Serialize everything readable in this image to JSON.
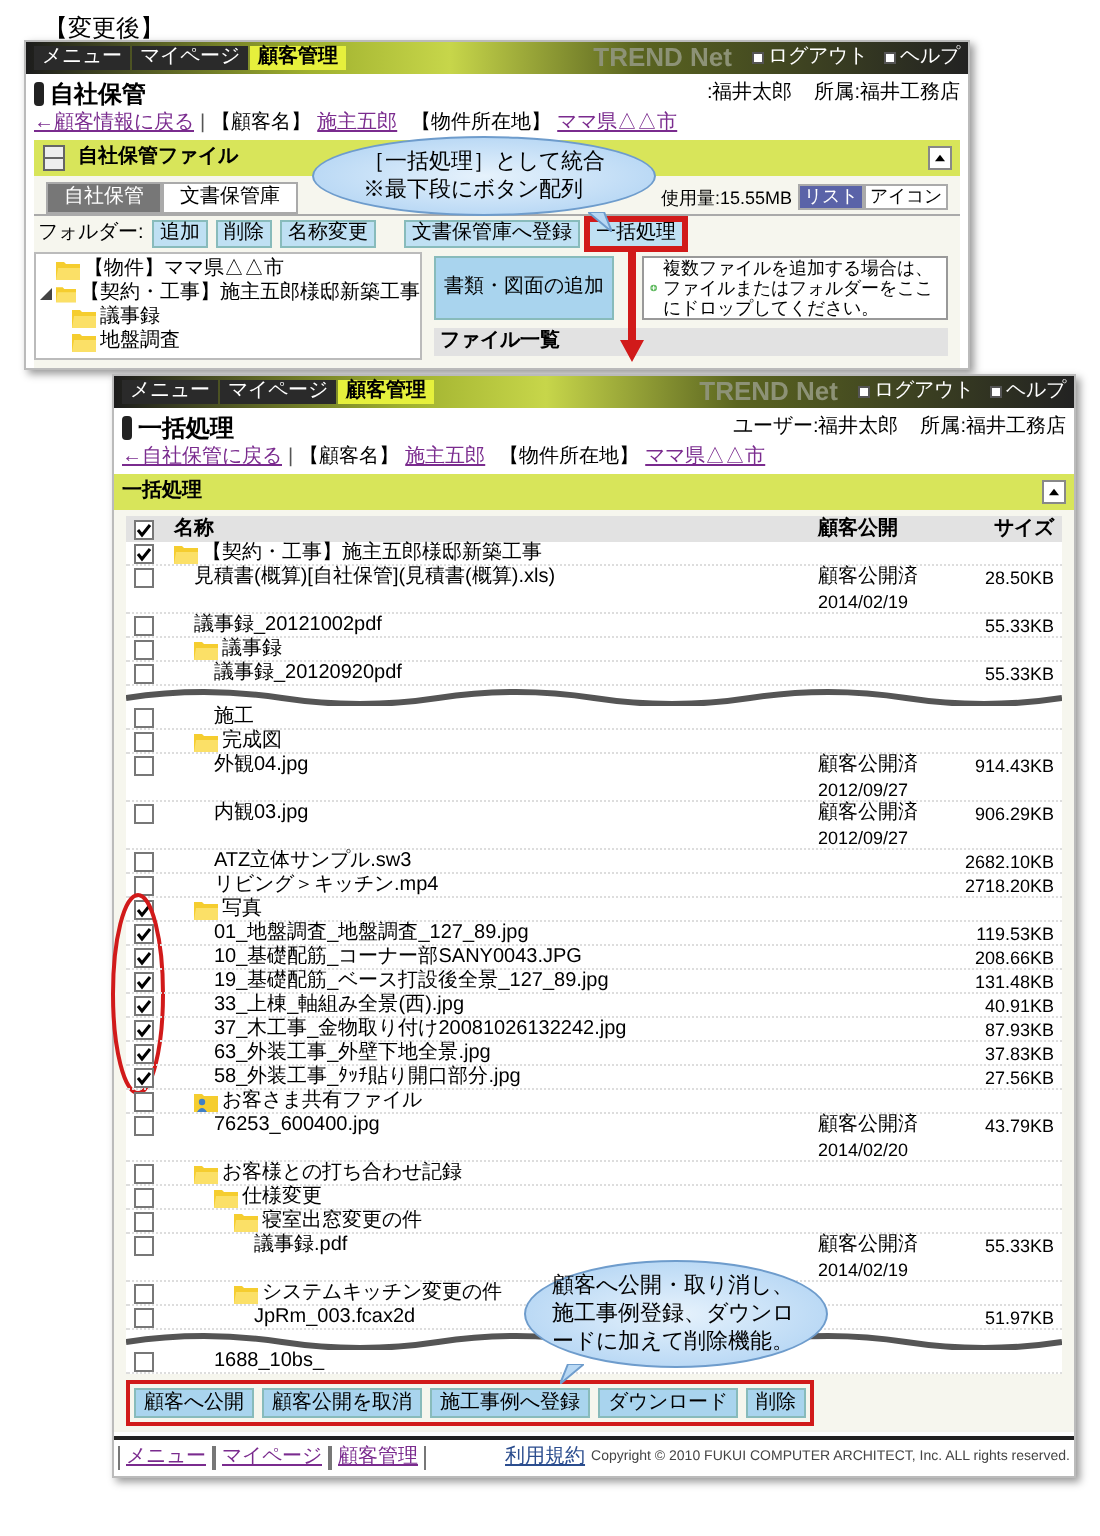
{
  "heading": "【変更後】",
  "screen1": {
    "nav": {
      "tabs": [
        {
          "label": "メニュー",
          "selected": false
        },
        {
          "label": "マイページ",
          "selected": false
        },
        {
          "label": "顧客管理",
          "selected": true
        }
      ],
      "brand": "TREND Net",
      "links": [
        "ログアウト",
        "ヘルプ"
      ]
    },
    "title": "自社保管",
    "user": ":福井太郎",
    "affiliation": "所属:福井工務店",
    "breadcrumb": {
      "back": "←顧客情報に戻る",
      "separator": "|",
      "customer_label": "【顧客名】",
      "customer": "施主五郎",
      "location_label": "【物件所在地】",
      "location": "ママ県△△市"
    },
    "section": "自社保管ファイル",
    "tabs": [
      {
        "label": "自社保管",
        "selected": true
      },
      {
        "label": "文書保管庫",
        "selected": false
      }
    ],
    "usage": "使用量:15.55MB",
    "views": [
      {
        "label": "リスト",
        "selected": true
      },
      {
        "label": "アイコン",
        "selected": false
      }
    ],
    "folder_label": "フォルダー:",
    "folder_buttons": [
      "追加",
      "削除",
      "名称変更"
    ],
    "actions": [
      {
        "label": "文書保管庫へ登録",
        "highlighted": false
      },
      {
        "label": "一括処理",
        "highlighted": true
      }
    ],
    "tree": [
      {
        "name": "【物件】ママ県△△市"
      },
      {
        "name": "【契約・工事】施主五郎様邸新築工事",
        "expanded": true,
        "children": [
          {
            "name": "議事録"
          },
          {
            "name": "地盤調査"
          }
        ]
      }
    ],
    "add_button": "書類・図面の追加",
    "drop_hint": "複数ファイルを追加する場合は、ファイルまたはフォルダーをここにドロップしてください。",
    "file_list": "ファイル一覧"
  },
  "callouts": [
    {
      "text": "［一括処理］として統合\n※最下段にボタン配列"
    },
    {
      "text": "顧客へ公開・取り消し、施工事例登録、ダウンロードに加えて削除機能。"
    }
  ],
  "screen2": {
    "nav": {
      "tabs": [
        {
          "label": "メニュー",
          "selected": false
        },
        {
          "label": "マイページ",
          "selected": false
        },
        {
          "label": "顧客管理",
          "selected": true
        }
      ],
      "brand": "TREND Net",
      "links": [
        "ログアウト",
        "ヘルプ"
      ]
    },
    "title": "一括処理",
    "user": "ユーザー:福井太郎",
    "affiliation": "所属:福井工務店",
    "breadcrumb": {
      "back": "←自社保管に戻る",
      "separator": "|",
      "customer_label": "【顧客名】",
      "customer": "施主五郎",
      "location_label": "【物件所在地】",
      "location": "ママ県△△市"
    },
    "section": "一括処理",
    "columns": [
      "名称",
      "顧客公開",
      "サイズ"
    ],
    "all_checked": true,
    "segments": [
      {
        "rows": [
          {
            "kind": "folder",
            "name": "【契約・工事】施主五郎様邸新築工事",
            "checked": true,
            "children": [
              {
                "kind": "file",
                "name": "見積書(概算)[自社保管](見積書(概算).xls)",
                "checked": false,
                "public": "顧客公開済",
                "date": "2014/02/19",
                "size": "28.50KB"
              },
              {
                "kind": "file",
                "name": "議事録_20121002pdf",
                "checked": false,
                "size": "55.33KB"
              },
              {
                "kind": "folder",
                "name": "議事録",
                "checked": false,
                "children": [
                  {
                    "kind": "file",
                    "name": "議事録_20120920pdf",
                    "checked": false,
                    "size": "55.33KB"
                  }
                ]
              }
            ]
          }
        ]
      },
      {
        "rows": [
          {
            "children": [
              {
                "children": [
                  {
                    "kind": "file",
                    "name": "施工",
                    "checked": false
                  }
                ]
              },
              {
                "kind": "folder",
                "name": "完成図",
                "checked": false,
                "children": [
                  {
                    "kind": "file",
                    "name": "外観04.jpg",
                    "checked": false,
                    "public": "顧客公開済",
                    "date": "2012/09/27",
                    "size": "914.43KB"
                  },
                  {
                    "kind": "file",
                    "name": "内観03.jpg",
                    "checked": false,
                    "public": "顧客公開済",
                    "date": "2012/09/27",
                    "size": "906.29KB"
                  },
                  {
                    "kind": "file",
                    "name": "ATZ立体サンプル.sw3",
                    "checked": false,
                    "size": "2682.10KB"
                  },
                  {
                    "kind": "file",
                    "name": "リビング＞キッチン.mp4",
                    "checked": false,
                    "size": "2718.20KB"
                  }
                ]
              },
              {
                "kind": "folder",
                "name": "写真",
                "checked": true,
                "highlighted": true,
                "children": [
                  {
                    "kind": "file",
                    "name": "01_地盤調査_地盤調査_127_89.jpg",
                    "checked": true,
                    "size": "119.53KB"
                  },
                  {
                    "kind": "file",
                    "name": "10_基礎配筋_コーナー部SANY0043.JPG",
                    "checked": true,
                    "size": "208.66KB"
                  },
                  {
                    "kind": "file",
                    "name": "19_基礎配筋_ベース打設後全景_127_89.jpg",
                    "checked": true,
                    "size": "131.48KB"
                  },
                  {
                    "kind": "file",
                    "name": "33_上棟_軸組み全景(西).jpg",
                    "checked": true,
                    "size": "40.91KB"
                  },
                  {
                    "kind": "file",
                    "name": "37_木工事_金物取り付け20081026132242.jpg",
                    "checked": true,
                    "size": "87.93KB"
                  },
                  {
                    "kind": "file",
                    "name": "63_外装工事_外壁下地全景.jpg",
                    "checked": true,
                    "size": "37.83KB"
                  },
                  {
                    "kind": "file",
                    "name": "58_外装工事_ﾀｯﾁ貼り開口部分.jpg",
                    "checked": true,
                    "size": "27.56KB"
                  }
                ]
              },
              {
                "kind": "shared",
                "name": "お客さま共有ファイル",
                "checked": false,
                "children": [
                  {
                    "kind": "file",
                    "name": "76253_600400.jpg",
                    "checked": false,
                    "public": "顧客公開済",
                    "date": "2014/02/20",
                    "size": "43.79KB"
                  }
                ]
              },
              {
                "kind": "folder",
                "name": "お客様との打ち合わせ記録",
                "checked": false,
                "children": [
                  {
                    "kind": "folder",
                    "name": "仕様変更",
                    "checked": false,
                    "children": [
                      {
                        "kind": "folder",
                        "name": "寝室出窓変更の件",
                        "checked": false,
                        "children": [
                          {
                            "kind": "file",
                            "name": "議事録.pdf",
                            "checked": false,
                            "public": "顧客公開済",
                            "date": "2014/02/19",
                            "size": "55.33KB"
                          }
                        ]
                      },
                      {
                        "kind": "folder",
                        "name": "システムキッチン変更の件",
                        "checked": false,
                        "children": [
                          {
                            "kind": "file",
                            "name": "JpRm_003.fcax2d",
                            "checked": false,
                            "size": "51.97KB"
                          }
                        ]
                      }
                    ]
                  }
                ]
              }
            ]
          }
        ]
      },
      {
        "rows": [
          {
            "children": [
              {
                "children": [
                  {
                    "kind": "file",
                    "name": "1688_10bs_",
                    "checked": false
                  }
                ]
              }
            ]
          }
        ]
      }
    ],
    "buttons": [
      "顧客へ公開",
      "顧客公開を取消",
      "施工事例へ登録",
      "ダウンロード",
      "削除"
    ],
    "buttons_highlighted": true,
    "footer_links": [
      "メニュー",
      "マイページ",
      "顧客管理"
    ],
    "terms": "利用規約",
    "copyright": "Copyright © 2010 FUKUI COMPUTER ARCHITECT, Inc. ALL rights reserved."
  }
}
